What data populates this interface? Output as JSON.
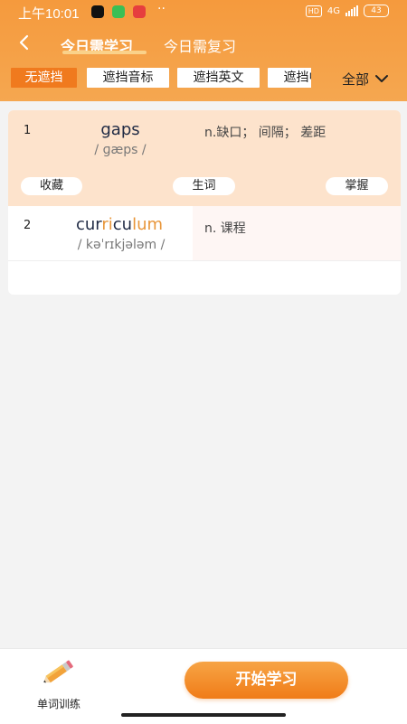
{
  "status_bar": {
    "time": "上午10:01",
    "hd": "HD",
    "network": "4G",
    "battery": "43"
  },
  "nav": {
    "tabs": [
      {
        "label": "今日需学习",
        "active": true
      },
      {
        "label": "今日需复习",
        "active": false
      }
    ]
  },
  "filters": {
    "chips": [
      "无遮挡",
      "遮挡音标",
      "遮挡英文",
      "遮挡中文"
    ],
    "active_index": 0,
    "dropdown_label": "全部"
  },
  "words": [
    {
      "index": "1",
      "word": "gaps",
      "phonetic": "/ ɡæps /",
      "meaning": "n.缺口； 间隔； 差距"
    },
    {
      "index": "2",
      "word_parts": [
        "cur",
        "ri",
        "cu",
        "lum"
      ],
      "phonetic": "/ kəˈrɪkjələm /",
      "meaning": "n. 课程"
    }
  ],
  "word_actions": [
    "收藏",
    "生词",
    "掌握"
  ],
  "bottom": {
    "train_label": "单词训练",
    "start_button": "开始学习"
  },
  "colors": {
    "accent": "#f07a1e",
    "header": "#f59a3d",
    "highlight_row": "#fde3cc",
    "word_dark": "#1f2a44",
    "word_orange": "#e8963a"
  }
}
